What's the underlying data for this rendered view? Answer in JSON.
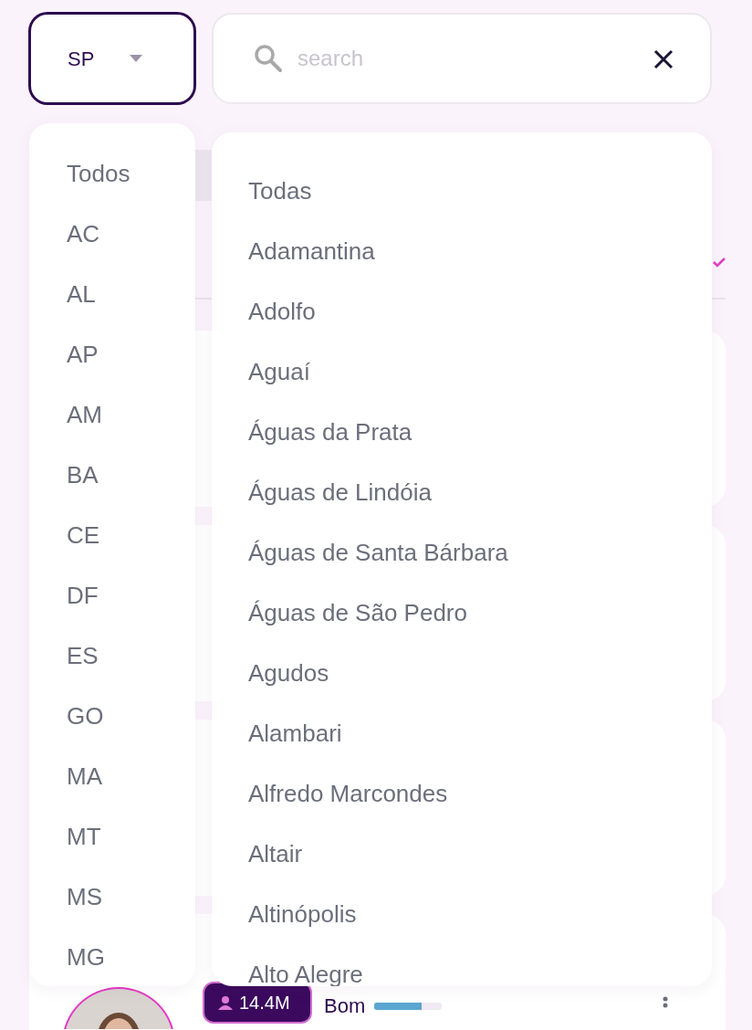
{
  "state_select": {
    "value": "SP",
    "expanded": true
  },
  "search": {
    "placeholder": "search"
  },
  "state_menu": {
    "items": [
      {
        "label": "Todos",
        "selected": false
      },
      {
        "label": "AC",
        "selected": false
      },
      {
        "label": "AL",
        "selected": false
      },
      {
        "label": "AP",
        "selected": false
      },
      {
        "label": "AM",
        "selected": false
      },
      {
        "label": "BA",
        "selected": false
      },
      {
        "label": "CE",
        "selected": false
      },
      {
        "label": "DF",
        "selected": false
      },
      {
        "label": "ES",
        "selected": false
      },
      {
        "label": "GO",
        "selected": false
      },
      {
        "label": "MA",
        "selected": false
      },
      {
        "label": "MT",
        "selected": false
      },
      {
        "label": "MS",
        "selected": false
      },
      {
        "label": "MG",
        "selected": false
      }
    ]
  },
  "city_menu": {
    "items": [
      {
        "label": "Todas",
        "selected": false
      },
      {
        "label": "Adamantina",
        "selected": false
      },
      {
        "label": "Adolfo",
        "selected": false
      },
      {
        "label": "Aguaí",
        "selected": false
      },
      {
        "label": "Águas da Prata",
        "selected": false
      },
      {
        "label": "Águas de Lindóia",
        "selected": false
      },
      {
        "label": "Águas de Santa Bárbara",
        "selected": false
      },
      {
        "label": "Águas de São Pedro",
        "selected": false
      },
      {
        "label": "Agudos",
        "selected": false
      },
      {
        "label": "Alambari",
        "selected": false
      },
      {
        "label": "Alfredo Marcondes",
        "selected": false
      },
      {
        "label": "Altair",
        "selected": false
      },
      {
        "label": "Altinópolis",
        "selected": false
      },
      {
        "label": "Alto Alegre",
        "selected": false
      }
    ]
  },
  "result_card": {
    "followers": "14.4M",
    "rating": "Bom",
    "level": 0.7
  }
}
